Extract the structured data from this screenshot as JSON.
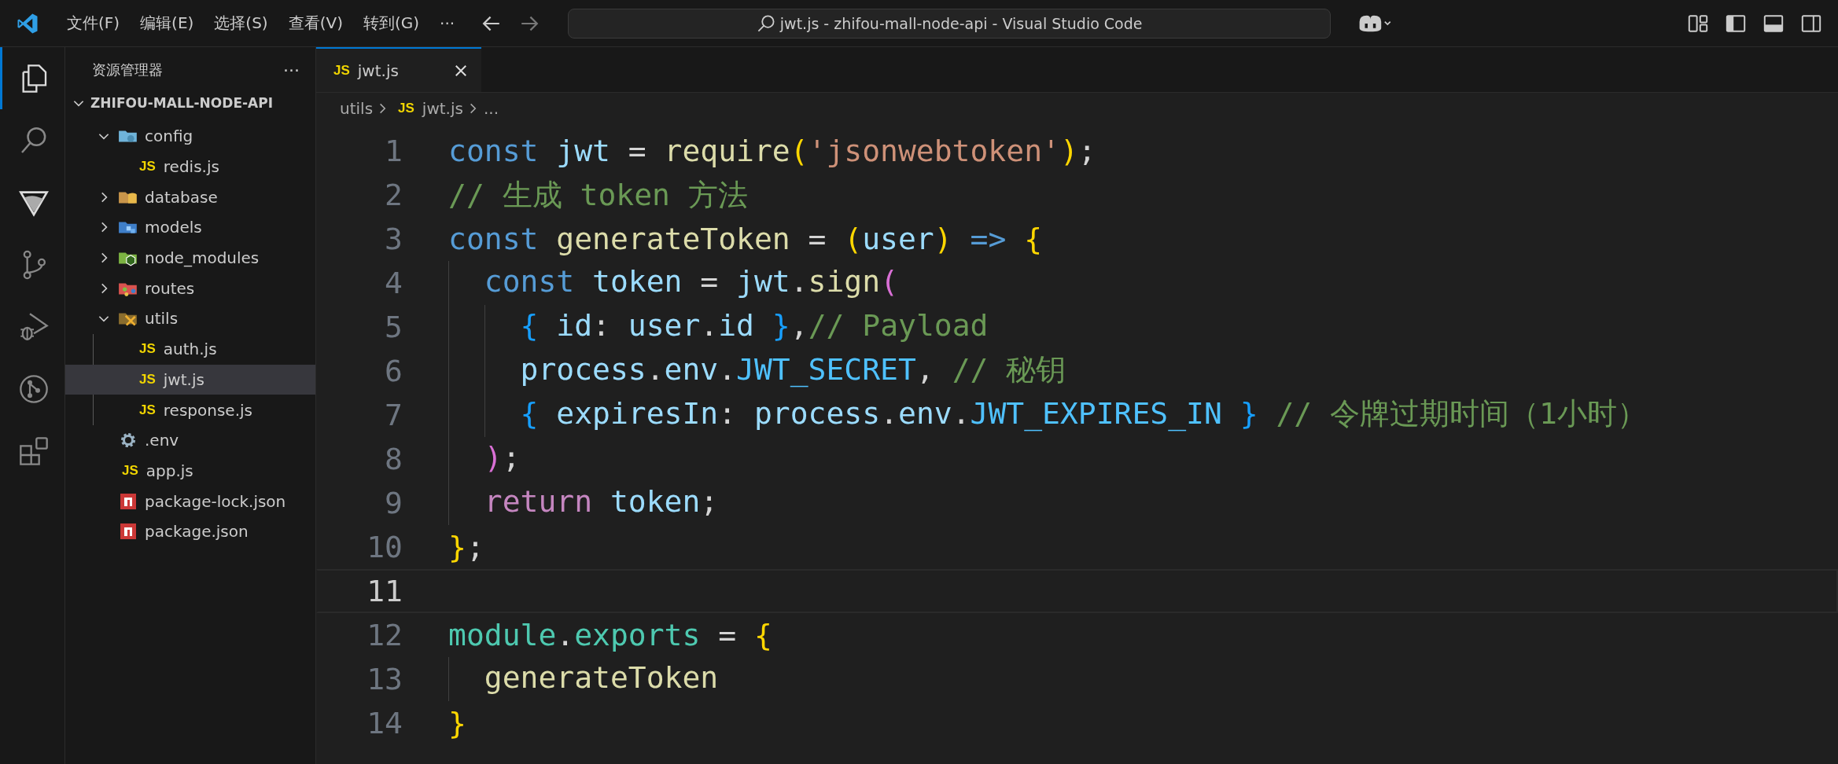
{
  "titlebar": {
    "menus": [
      "文件(F)",
      "编辑(E)",
      "选择(S)",
      "查看(V)",
      "转到(G)"
    ],
    "more": "···",
    "search_title": "jwt.js - zhifou-mall-node-api - Visual Studio Code"
  },
  "activity_bar": [
    {
      "kind": "explorer",
      "selected": true
    },
    {
      "kind": "search",
      "selected": false
    },
    {
      "kind": "triangle",
      "selected": false
    },
    {
      "kind": "branch",
      "selected": false
    },
    {
      "kind": "debug",
      "selected": false
    },
    {
      "kind": "graph",
      "selected": false
    },
    {
      "kind": "extensions",
      "selected": false
    }
  ],
  "sidebar": {
    "title": "资源管理器",
    "more": "···",
    "project": "ZHIFOU-MALL-NODE-API",
    "tree": [
      {
        "label": "config",
        "kind": "config",
        "expanded": true,
        "selected": false,
        "children": [
          {
            "label": "redis.js",
            "kind": "js",
            "badge": "JS",
            "selected": false
          }
        ]
      },
      {
        "label": "database",
        "kind": "database",
        "expanded": false,
        "selected": false
      },
      {
        "label": "models",
        "kind": "models",
        "expanded": false,
        "selected": false
      },
      {
        "label": "node_modules",
        "kind": "nodemodules",
        "expanded": false,
        "selected": false
      },
      {
        "label": "routes",
        "kind": "routes",
        "expanded": false,
        "selected": false
      },
      {
        "label": "utils",
        "kind": "utils",
        "expanded": true,
        "selected": false,
        "children": [
          {
            "label": "auth.js",
            "kind": "js",
            "badge": "JS",
            "selected": false
          },
          {
            "label": "jwt.js",
            "kind": "js",
            "badge": "JS",
            "selected": true
          },
          {
            "label": "response.js",
            "kind": "js",
            "badge": "JS",
            "selected": false
          }
        ]
      },
      {
        "label": ".env",
        "kind": "env",
        "selected": false
      },
      {
        "label": "app.js",
        "kind": "js",
        "badge": "JS",
        "selected": false
      },
      {
        "label": "package-lock.json",
        "kind": "npm",
        "selected": false
      },
      {
        "label": "package.json",
        "kind": "npm",
        "selected": false
      }
    ]
  },
  "tabs": [
    {
      "label": "jwt.js",
      "badge": "JS",
      "selected": true
    }
  ],
  "breadcrumb": {
    "folder": "utils",
    "badge": "JS",
    "file": "jwt.js",
    "more": "..."
  },
  "editor": {
    "lines": [
      {
        "number": "1",
        "current": false,
        "tokens": [
          {
            "kind": "kw",
            "text": "const"
          },
          {
            "kind": "var",
            "text": " jwt"
          },
          {
            "kind": "op",
            "text": " = "
          },
          {
            "kind": "fn",
            "text": "require"
          },
          {
            "kind": "b1",
            "text": "("
          },
          {
            "kind": "str",
            "text": "'jsonwebtoken'"
          },
          {
            "kind": "b1",
            "text": ")"
          },
          {
            "kind": "op",
            "text": ";"
          }
        ]
      },
      {
        "number": "2",
        "current": false,
        "tokens": [
          {
            "kind": "cmt",
            "text": "// 生成 token 方法"
          }
        ]
      },
      {
        "number": "3",
        "current": false,
        "tokens": [
          {
            "kind": "kw",
            "text": "const"
          },
          {
            "kind": "fn",
            "text": " generateToken"
          },
          {
            "kind": "op",
            "text": " = "
          },
          {
            "kind": "b1",
            "text": "("
          },
          {
            "kind": "var",
            "text": "user"
          },
          {
            "kind": "b1",
            "text": ")"
          },
          {
            "kind": "kw",
            "text": " => "
          },
          {
            "kind": "b1",
            "text": "{"
          }
        ]
      },
      {
        "number": "4",
        "current": false,
        "tokens": [
          {
            "kind": "kw",
            "text": "  const"
          },
          {
            "kind": "var",
            "text": " token"
          },
          {
            "kind": "op",
            "text": " = "
          },
          {
            "kind": "var",
            "text": "jwt"
          },
          {
            "kind": "op",
            "text": "."
          },
          {
            "kind": "fn",
            "text": "sign"
          },
          {
            "kind": "b2",
            "text": "("
          }
        ]
      },
      {
        "number": "5",
        "current": false,
        "tokens": [
          {
            "kind": "b3",
            "text": "    {"
          },
          {
            "kind": "var",
            "text": " id"
          },
          {
            "kind": "op",
            "text": ": "
          },
          {
            "kind": "var",
            "text": "user"
          },
          {
            "kind": "op",
            "text": "."
          },
          {
            "kind": "var",
            "text": "id"
          },
          {
            "kind": "b3",
            "text": " }"
          },
          {
            "kind": "op",
            "text": ","
          },
          {
            "kind": "cmt",
            "text": "// Payload"
          }
        ]
      },
      {
        "number": "6",
        "current": false,
        "tokens": [
          {
            "kind": "var",
            "text": "    process"
          },
          {
            "kind": "op",
            "text": "."
          },
          {
            "kind": "var",
            "text": "env"
          },
          {
            "kind": "op",
            "text": "."
          },
          {
            "kind": "const",
            "text": "JWT_SECRET"
          },
          {
            "kind": "op",
            "text": ", "
          },
          {
            "kind": "cmt",
            "text": "// 秘钥"
          }
        ]
      },
      {
        "number": "7",
        "current": false,
        "tokens": [
          {
            "kind": "b3",
            "text": "    {"
          },
          {
            "kind": "var",
            "text": " expiresIn"
          },
          {
            "kind": "op",
            "text": ": "
          },
          {
            "kind": "var",
            "text": "process"
          },
          {
            "kind": "op",
            "text": "."
          },
          {
            "kind": "var",
            "text": "env"
          },
          {
            "kind": "op",
            "text": "."
          },
          {
            "kind": "const",
            "text": "JWT_EXPIRES_IN"
          },
          {
            "kind": "b3",
            "text": " }"
          },
          {
            "kind": "cmt",
            "text": " // 令牌过期时间（1小时）"
          }
        ]
      },
      {
        "number": "8",
        "current": false,
        "tokens": [
          {
            "kind": "b2",
            "text": "  )"
          },
          {
            "kind": "op",
            "text": ";"
          }
        ]
      },
      {
        "number": "9",
        "current": false,
        "tokens": [
          {
            "kind": "ctl",
            "text": "  return"
          },
          {
            "kind": "var",
            "text": " token"
          },
          {
            "kind": "op",
            "text": ";"
          }
        ]
      },
      {
        "number": "10",
        "current": false,
        "tokens": [
          {
            "kind": "b1",
            "text": "}"
          },
          {
            "kind": "op",
            "text": ";"
          }
        ]
      },
      {
        "number": "11",
        "current": true
      },
      {
        "number": "12",
        "current": false,
        "tokens": [
          {
            "kind": "mod",
            "text": "module"
          },
          {
            "kind": "op",
            "text": "."
          },
          {
            "kind": "mod",
            "text": "exports"
          },
          {
            "kind": "op",
            "text": " = "
          },
          {
            "kind": "b1",
            "text": "{"
          }
        ]
      },
      {
        "number": "13",
        "current": false,
        "tokens": [
          {
            "kind": "fn",
            "text": "  generateToken"
          }
        ]
      },
      {
        "number": "14",
        "current": false,
        "tokens": [
          {
            "kind": "b1",
            "text": "}"
          }
        ]
      }
    ]
  }
}
